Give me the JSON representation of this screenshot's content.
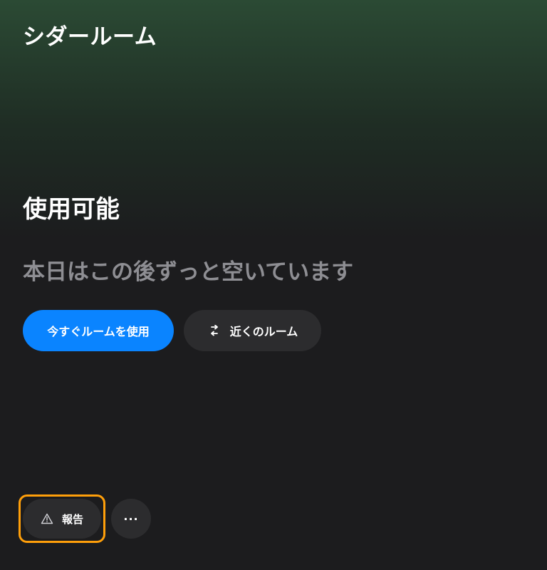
{
  "room": {
    "name": "シダールーム"
  },
  "status": {
    "title": "使用可能",
    "subtitle": "本日はこの後ずっと空いています"
  },
  "actions": {
    "primary_label": "今すぐルームを使用",
    "secondary_label": "近くのルーム",
    "secondary_icon": "swap-arrows-icon"
  },
  "bottom": {
    "report_label": "報告",
    "report_icon": "warning-triangle-icon",
    "more_label": "···",
    "more_icon": "ellipsis-icon"
  },
  "colors": {
    "primary": "#0a84ff",
    "focus_ring": "#ff9f0a",
    "secondary_bg": "#2c2c2e",
    "subtitle_text": "#8e8e93",
    "header_green": "#2b4a34"
  }
}
